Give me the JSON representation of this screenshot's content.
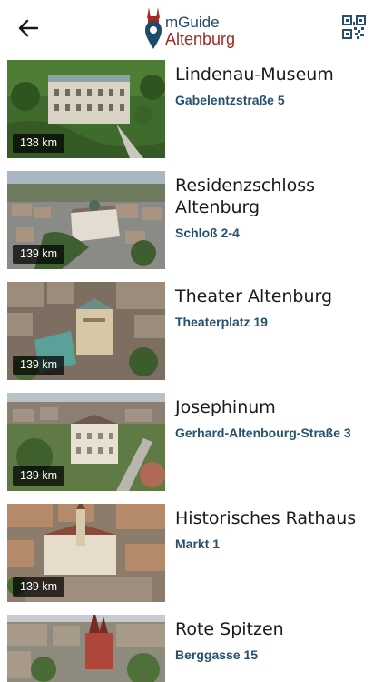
{
  "header": {
    "logo_top": "mGuide",
    "logo_bottom": "Altenburg"
  },
  "items": [
    {
      "title": "Lindenau-Museum",
      "address": "Gabelentzstraße 5",
      "distance": "138 km"
    },
    {
      "title": "Residenzschloss Altenburg",
      "address": "Schloß 2-4",
      "distance": "139 km"
    },
    {
      "title": "Theater Altenburg",
      "address": "Theaterplatz 19",
      "distance": "139 km"
    },
    {
      "title": "Josephinum",
      "address": "Gerhard-Altenbourg-Straße 3",
      "distance": "139 km"
    },
    {
      "title": "Historisches Rathaus",
      "address": "Markt 1",
      "distance": "139 km"
    },
    {
      "title": "Rote Spitzen",
      "address": "Berggasse 15",
      "distance": ""
    }
  ],
  "colors": {
    "brand_blue": "#1e4a6b",
    "brand_red": "#a02a24",
    "address": "#27506f"
  },
  "icons": {
    "back": "arrow-left-icon",
    "qr": "qr-code-icon",
    "logo": "location-pin-logo"
  }
}
